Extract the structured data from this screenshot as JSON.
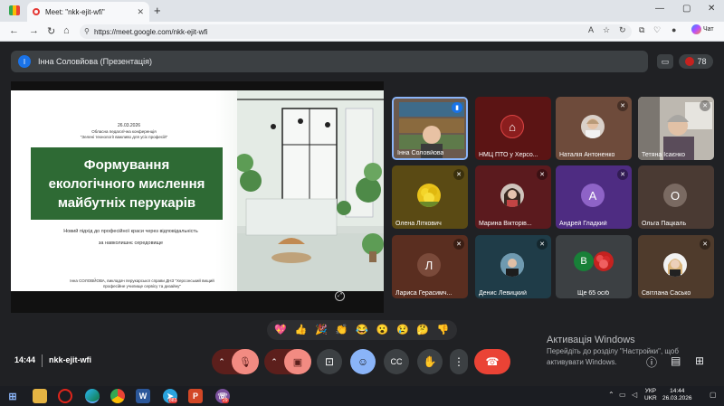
{
  "browser": {
    "tab_title": "Meet: \"nkk-ejit-wfi\"",
    "tab_close": "✕",
    "new_tab": "+",
    "url": "https://meet.google.com/nkk-ejit-wfi",
    "chat_label": "Чат",
    "window_controls": [
      "—",
      "▢",
      "✕"
    ]
  },
  "meet": {
    "presenter_initial": "І",
    "presenter_title": "Інна Соловйова (Презентація)",
    "participant_count": "78"
  },
  "slide": {
    "date": "26.03.2026",
    "conference_line1": "Обласна педагогічна конференція",
    "conference_line2": "\"Зелені технології важливо для усіх професій\"",
    "title_line1": "Формування",
    "title_line2": "екологічного мислення",
    "title_line3": "майбутніх перукарів",
    "subtitle_line1": "Новий підхід до професійної краси через відповідальність",
    "subtitle_line2": "за навколишнє середовище",
    "author_line1": "Інна СОЛОВЙОВА, викладач перукарської справи ДНЗ \"Херсонський вищий",
    "author_line2": "професійне училище сервісу та дизайну\""
  },
  "participants": [
    {
      "name": "Інна Соловйова",
      "type": "video-shelf",
      "mic_off": false,
      "active": true
    },
    {
      "name": "НМЦ ПТО у Херсо...",
      "type": "logo",
      "mic_off": false
    },
    {
      "name": "Наталія Антоненко",
      "type": "photo",
      "mic_off": true
    },
    {
      "name": "Тетяна Ісаєнко",
      "type": "video-room",
      "mic_off": true
    },
    {
      "name": "Олена Літкович",
      "type": "photo",
      "mic_off": true
    },
    {
      "name": "Марина Вікторів...",
      "type": "photo",
      "mic_off": true
    },
    {
      "name": "Андрей Гладкий",
      "type": "letter",
      "letter": "А",
      "mic_off": true
    },
    {
      "name": "Ольга Пацкаль",
      "type": "letter",
      "letter": "О",
      "mic_off": false
    },
    {
      "name": "Лариса Герасимч...",
      "type": "letter",
      "letter": "Л",
      "mic_off": true
    },
    {
      "name": "Денис Левицкий",
      "type": "photo",
      "mic_off": true
    },
    {
      "name": "Ще 65 осіб",
      "type": "more",
      "letter": "В",
      "mic_off": false
    },
    {
      "name": "Світлана Сасько",
      "type": "photo",
      "mic_off": true
    }
  ],
  "reactions": [
    "💖",
    "👍",
    "🎉",
    "👏",
    "😂",
    "😮",
    "😢",
    "🤔",
    "👎"
  ],
  "bottom": {
    "time": "14:44",
    "meeting_code": "nkk-ejit-wfi"
  },
  "watermark": {
    "line1": "Активація Windows",
    "line2": "Перейдіть до розділу \"Настройки\", щоб",
    "line3": "активувати Windows."
  },
  "taskbar": {
    "lang_line1": "УКР",
    "lang_line2": "UKR",
    "clock_time": "14:44",
    "clock_date": "26.03.2026",
    "telegram_badge": "883",
    "viber_badge": "29"
  },
  "colors": {
    "meet_bg": "#202124",
    "slide_green": "#2e6a34",
    "end_call": "#ea4335",
    "mic_off_red": "#c5221f",
    "reactions_active": "#8ab4f8"
  }
}
